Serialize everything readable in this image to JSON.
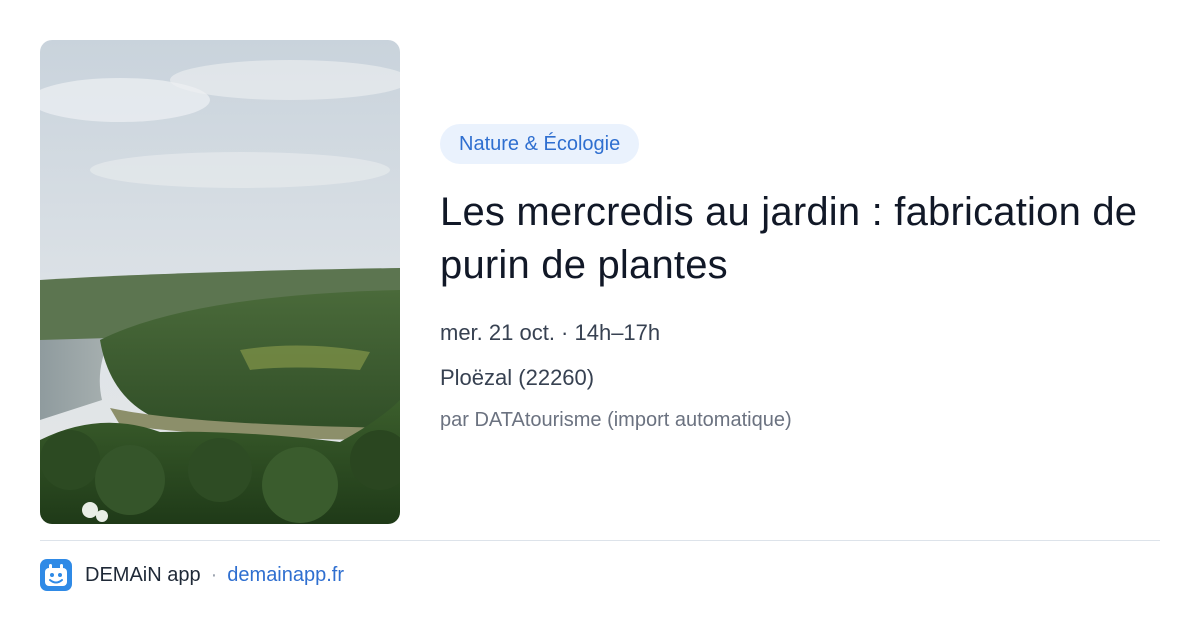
{
  "image": {
    "alt_icon": "landscape-photo"
  },
  "event": {
    "category": "Nature & Écologie",
    "title": "Les mercredis au jardin : fabrication de purin de plantes",
    "date_time": "mer. 21 oct. · 14h–17h",
    "location": "Ploëzal (22260)",
    "source": "par DATAtourisme (import automatique)"
  },
  "footer": {
    "app_name": "DEMAiN app",
    "separator": "·",
    "link_text": "demainapp.fr",
    "logo_icon": "demain-app-logo-icon"
  },
  "colors": {
    "accent": "#2f6fd0",
    "pill_bg": "#eaf2fd",
    "title": "#111827",
    "muted": "#6b7280",
    "divider": "#dde3ea"
  }
}
